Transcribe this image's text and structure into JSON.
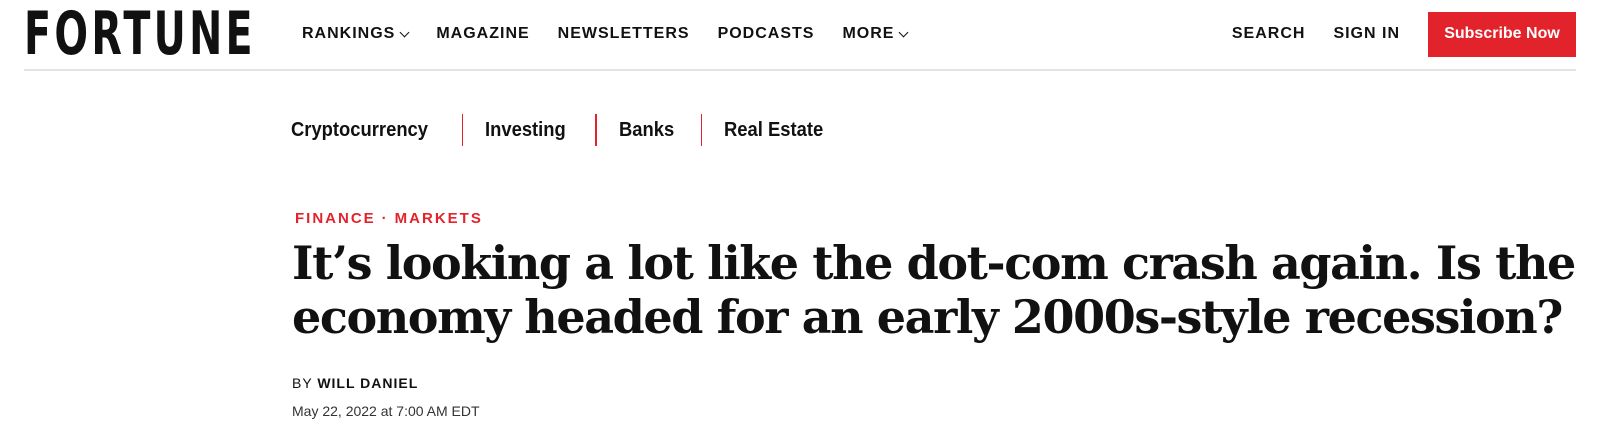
{
  "header": {
    "logo": "FORTUNE",
    "nav": [
      {
        "label": "RANKINGS"
      },
      {
        "label": "MAGAZINE"
      },
      {
        "label": "NEWSLETTERS"
      },
      {
        "label": "PODCASTS"
      },
      {
        "label": "MORE"
      }
    ],
    "search_label": "SEARCH",
    "signin_label": "SIGN IN",
    "subscribe_label": "Subscribe Now"
  },
  "subnav": [
    {
      "label": "Cryptocurrency"
    },
    {
      "label": "Investing"
    },
    {
      "label": "Banks"
    },
    {
      "label": "Real Estate"
    }
  ],
  "article": {
    "kicker": [
      "FINANCE",
      "MARKETS"
    ],
    "kicker_separator": "·",
    "headline": "It’s looking a lot like the dot-com crash again. Is the economy headed for an early 2000s-style recession?",
    "byline_prefix": "BY",
    "author": "WILL DANIEL",
    "date": "May 22, 2022 at 7:00 AM EDT"
  },
  "colors": {
    "accent": "#e3232b",
    "text": "#111111",
    "divider": "#e4e4e4"
  }
}
